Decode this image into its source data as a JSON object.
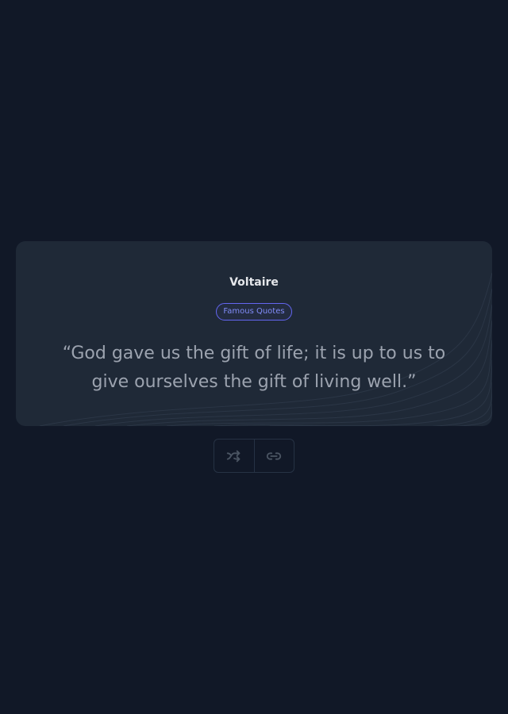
{
  "quote_card": {
    "author": "Voltaire",
    "tag": "Famous Quotes",
    "text": "“God gave us the gift of life; it is up to us to give ourselves the gift of living well.”"
  },
  "actions": {
    "items": [
      {
        "icon": "shuffle-icon"
      },
      {
        "icon": "link-icon"
      }
    ]
  },
  "colors": {
    "background": "#111827",
    "card": "#1f2937",
    "accent": "#6366f1",
    "quote_text": "#9ca3af",
    "author_text": "#e5e7eb"
  }
}
